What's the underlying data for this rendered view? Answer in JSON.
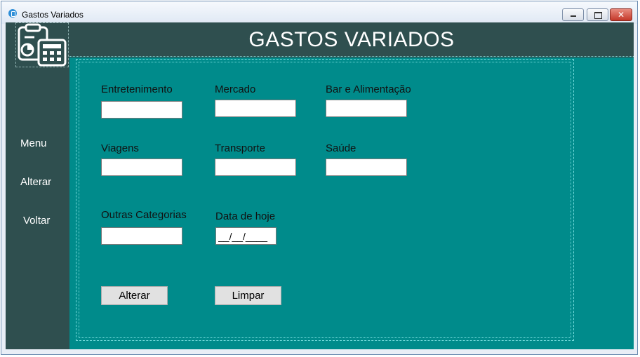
{
  "window": {
    "title": "Gastos Variados",
    "minimize_glyph": "",
    "maximize_glyph": "",
    "close_glyph": "✕"
  },
  "header": {
    "title": "GASTOS VARIADOS",
    "logo_icon": "clipboard-calculator-icon"
  },
  "sidebar": {
    "items": [
      {
        "label": "Menu"
      },
      {
        "label": "Alterar"
      },
      {
        "label": "Voltar"
      }
    ]
  },
  "form": {
    "fields": [
      {
        "label": "Entretenimento",
        "value": ""
      },
      {
        "label": "Mercado",
        "value": ""
      },
      {
        "label": "Bar e Alimentação",
        "value": ""
      },
      {
        "label": "Viagens",
        "value": ""
      },
      {
        "label": "Transporte",
        "value": ""
      },
      {
        "label": "Saúde",
        "value": ""
      },
      {
        "label": "Outras Categorias",
        "value": ""
      }
    ],
    "date": {
      "label": "Data de hoje",
      "value": "__/__/____"
    },
    "buttons": {
      "alterar": "Alterar",
      "limpar": "Limpar"
    }
  },
  "colors": {
    "sidebar": "#2f4f4f",
    "background": "#008b8b",
    "text_light": "#ffffff"
  }
}
